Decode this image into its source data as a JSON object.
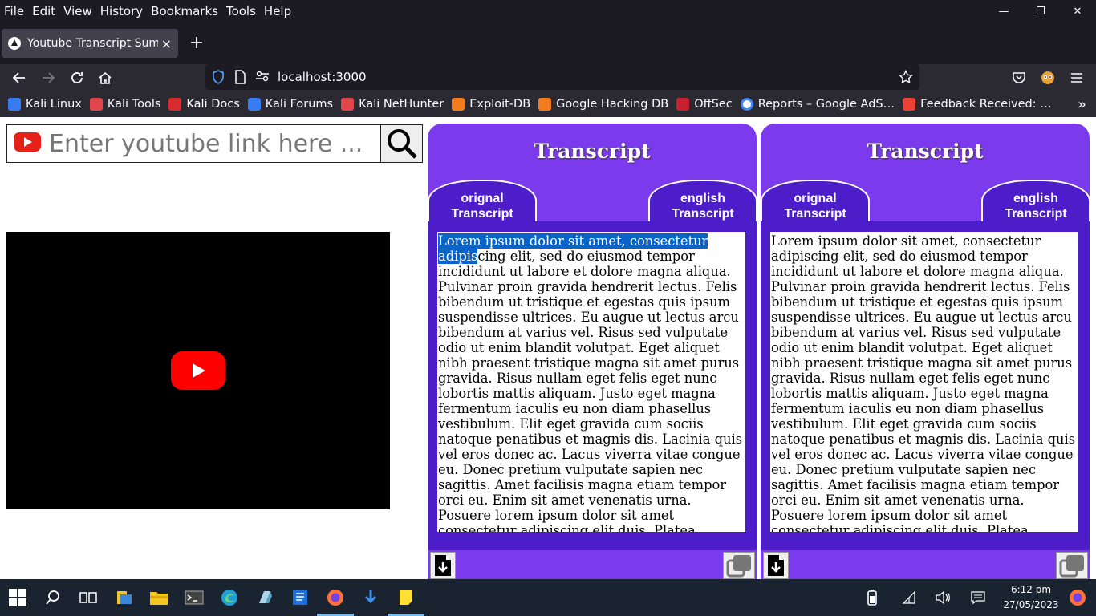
{
  "menubar": {
    "items": [
      "File",
      "Edit",
      "View",
      "History",
      "Bookmarks",
      "Tools",
      "Help"
    ]
  },
  "tab": {
    "title": "Youtube Transcript Summ",
    "close": "×",
    "new": "+"
  },
  "address": {
    "url": "localhost:3000"
  },
  "bookmarks": [
    {
      "label": "Kali Linux",
      "color": "#367bf0"
    },
    {
      "label": "Kali Tools",
      "color": "#e0474c"
    },
    {
      "label": "Kali Docs",
      "color": "#d62c2c"
    },
    {
      "label": "Kali Forums",
      "color": "#367bf0"
    },
    {
      "label": "Kali NetHunter",
      "color": "#e0474c"
    },
    {
      "label": "Exploit-DB",
      "color": "#f47c20"
    },
    {
      "label": "Google Hacking DB",
      "color": "#f47c20"
    },
    {
      "label": "OffSec",
      "color": "#c7202f"
    },
    {
      "label": "Reports – Google AdS…",
      "color": "#4285f4"
    },
    {
      "label": "Feedback Received: …",
      "color": "#ea4335"
    }
  ],
  "search": {
    "placeholder": "Enter youtube link here ..."
  },
  "panels": [
    {
      "title": "Transcript",
      "tab_left": "orignal\nTranscript",
      "tab_right": "english\nTranscript",
      "selected_text": "Lorem ipsum dolor sit amet, consectetur adipis",
      "text": "cing elit, sed do eiusmod tempor incididunt ut labore et dolore magna aliqua. Pulvinar proin gravida hendrerit lectus. Felis bibendum ut tristique et egestas quis ipsum suspendisse ultrices. Eu augue ut lectus arcu bibendum at varius vel. Risus sed vulputate odio ut enim blandit volutpat. Eget aliquet nibh praesent tristique magna sit amet purus gravida. Risus nullam eget felis eget nunc lobortis mattis aliquam. Justo eget magna fermentum iaculis eu non diam phasellus vestibulum. Elit eget gravida cum sociis natoque penatibus et magnis dis. Lacinia quis vel eros donec ac. Lacus viverra vitae congue eu. Donec pretium vulputate sapien nec sagittis. Amet facilisis magna etiam tempor orci eu. Enim sit amet venenatis urna. Posuere lorem ipsum dolor sit amet consectetur adipiscing elit duis. Platea dictumst quisque"
    },
    {
      "title": "Transcript",
      "tab_left": "orignal\nTranscript",
      "tab_right": "english\nTranscript",
      "text": "Lorem ipsum dolor sit amet, consectetur adipiscing elit, sed do eiusmod tempor incididunt ut labore et dolore magna aliqua. Pulvinar proin gravida hendrerit lectus. Felis bibendum ut tristique et egestas quis ipsum suspendisse ultrices. Eu augue ut lectus arcu bibendum at varius vel. Risus sed vulputate odio ut enim blandit volutpat. Eget aliquet nibh praesent tristique magna sit amet purus gravida. Risus nullam eget felis eget nunc lobortis mattis aliquam. Justo eget magna fermentum iaculis eu non diam phasellus vestibulum. Elit eget gravida cum sociis natoque penatibus et magnis dis. Lacinia quis vel eros donec ac. Lacus viverra vitae congue eu. Donec pretium vulputate sapien nec sagittis. Amet facilisis magna etiam tempor orci eu. Enim sit amet venenatis urna. Posuere lorem ipsum dolor sit amet consectetur adipiscing elit duis. Platea dictumst quisque"
    }
  ],
  "taskbar": {
    "time": "6:12 pm",
    "date": "27/05/2023"
  },
  "colors": {
    "panel": "#7c3aed",
    "panel_dark": "#4c1dc9",
    "youtube_red": "#ff0000"
  }
}
